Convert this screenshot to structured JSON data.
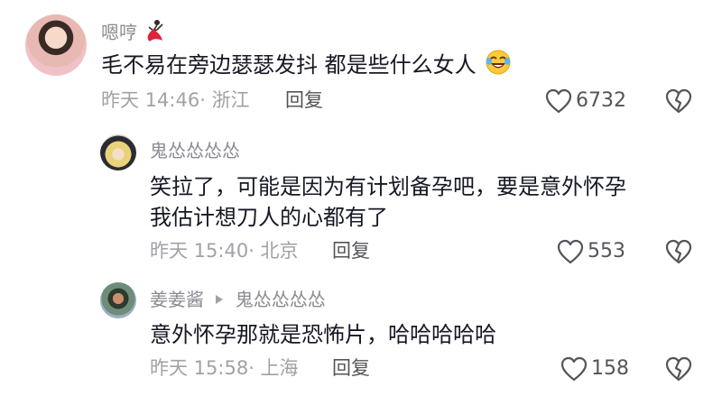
{
  "comments": [
    {
      "user": "嗯哼",
      "text": "毛不易在旁边瑟瑟发抖  都是些什么女人",
      "meta": "昨天 14:46· 浙江",
      "reply_label": "回复",
      "likes": "6732",
      "name_icon": "dancer-emoji-icon",
      "text_icon": "laughing-emoji-icon"
    },
    {
      "user": "鬼怂怂怂怂",
      "text_lines": [
        "笑拉了，可能是因为有计划备孕吧，要是意外怀孕",
        "我估计想刀人的心都有了"
      ],
      "meta": "昨天 15:40· 北京",
      "reply_label": "回复",
      "likes": "553"
    },
    {
      "user": "姜姜酱",
      "reply_to": "鬼怂怂怂怂",
      "text": "意外怀孕那就是恐怖片，哈哈哈哈哈",
      "meta": "昨天 15:58· 上海",
      "reply_label": "回复",
      "likes": "158"
    }
  ],
  "icons": {
    "like": "heart-outline-icon",
    "dislike": "broken-heart-icon",
    "reply_arrow": "play-triangle-icon"
  },
  "colors": {
    "username": "#8a8b91",
    "body": "#161823",
    "meta": "#a1a2a7",
    "icon": "#545559"
  }
}
